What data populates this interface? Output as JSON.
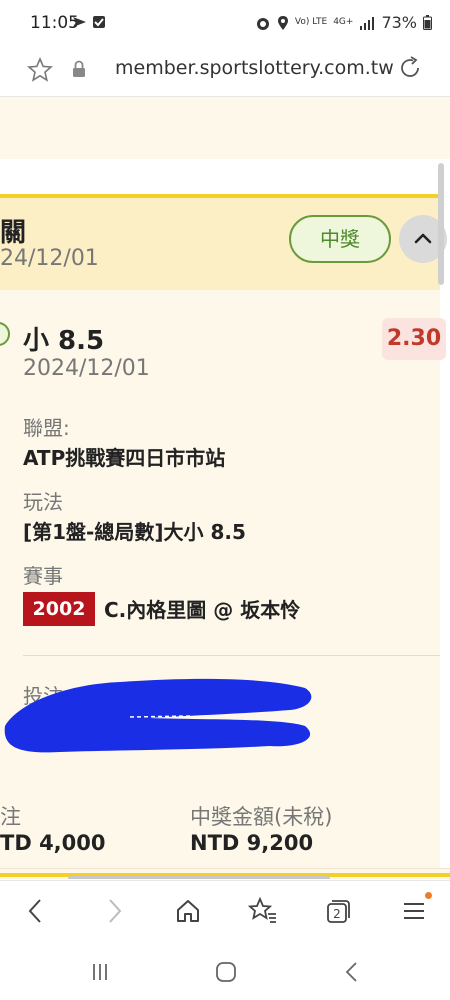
{
  "status_bar": {
    "time": "11:05",
    "battery": "73%",
    "network_volte": "Vo) LTE",
    "network_type": "4G+"
  },
  "browser": {
    "url": "member.sportslottery.com.tw"
  },
  "bet": {
    "header_title": "關",
    "header_date": "24/12/01",
    "status_badge": "中獎",
    "selection": "小 8.5",
    "selection_date": "2024/12/01",
    "odds": "2.30",
    "league_label": "聯盟:",
    "league_value": "ATP挑戰賽四日市市站",
    "play_label": "玩法",
    "play_value": "[第1盤-總局數]大小 8.5",
    "match_label": "賽事",
    "match_number": "2002",
    "match_name": "C.內格里圖 @ 坂本怜",
    "note_label": "投注"
  },
  "summary": {
    "stake_label": "注",
    "stake_value": "TD 4,000",
    "payout_label": "中獎金額(未稅)",
    "payout_value": "NTD 9,200"
  },
  "colors": {
    "accent_yellow": "#f3cf27",
    "win_green": "#4d8a2a",
    "odds_red": "#c0392b",
    "match_red": "#b8141b",
    "scribble_blue": "#1a2ee6"
  },
  "icons": {
    "toolbar": [
      "back-icon",
      "forward-icon",
      "home-icon",
      "bookmarks-icon",
      "tabs-icon",
      "menu-icon"
    ],
    "tabs_count": "2"
  }
}
